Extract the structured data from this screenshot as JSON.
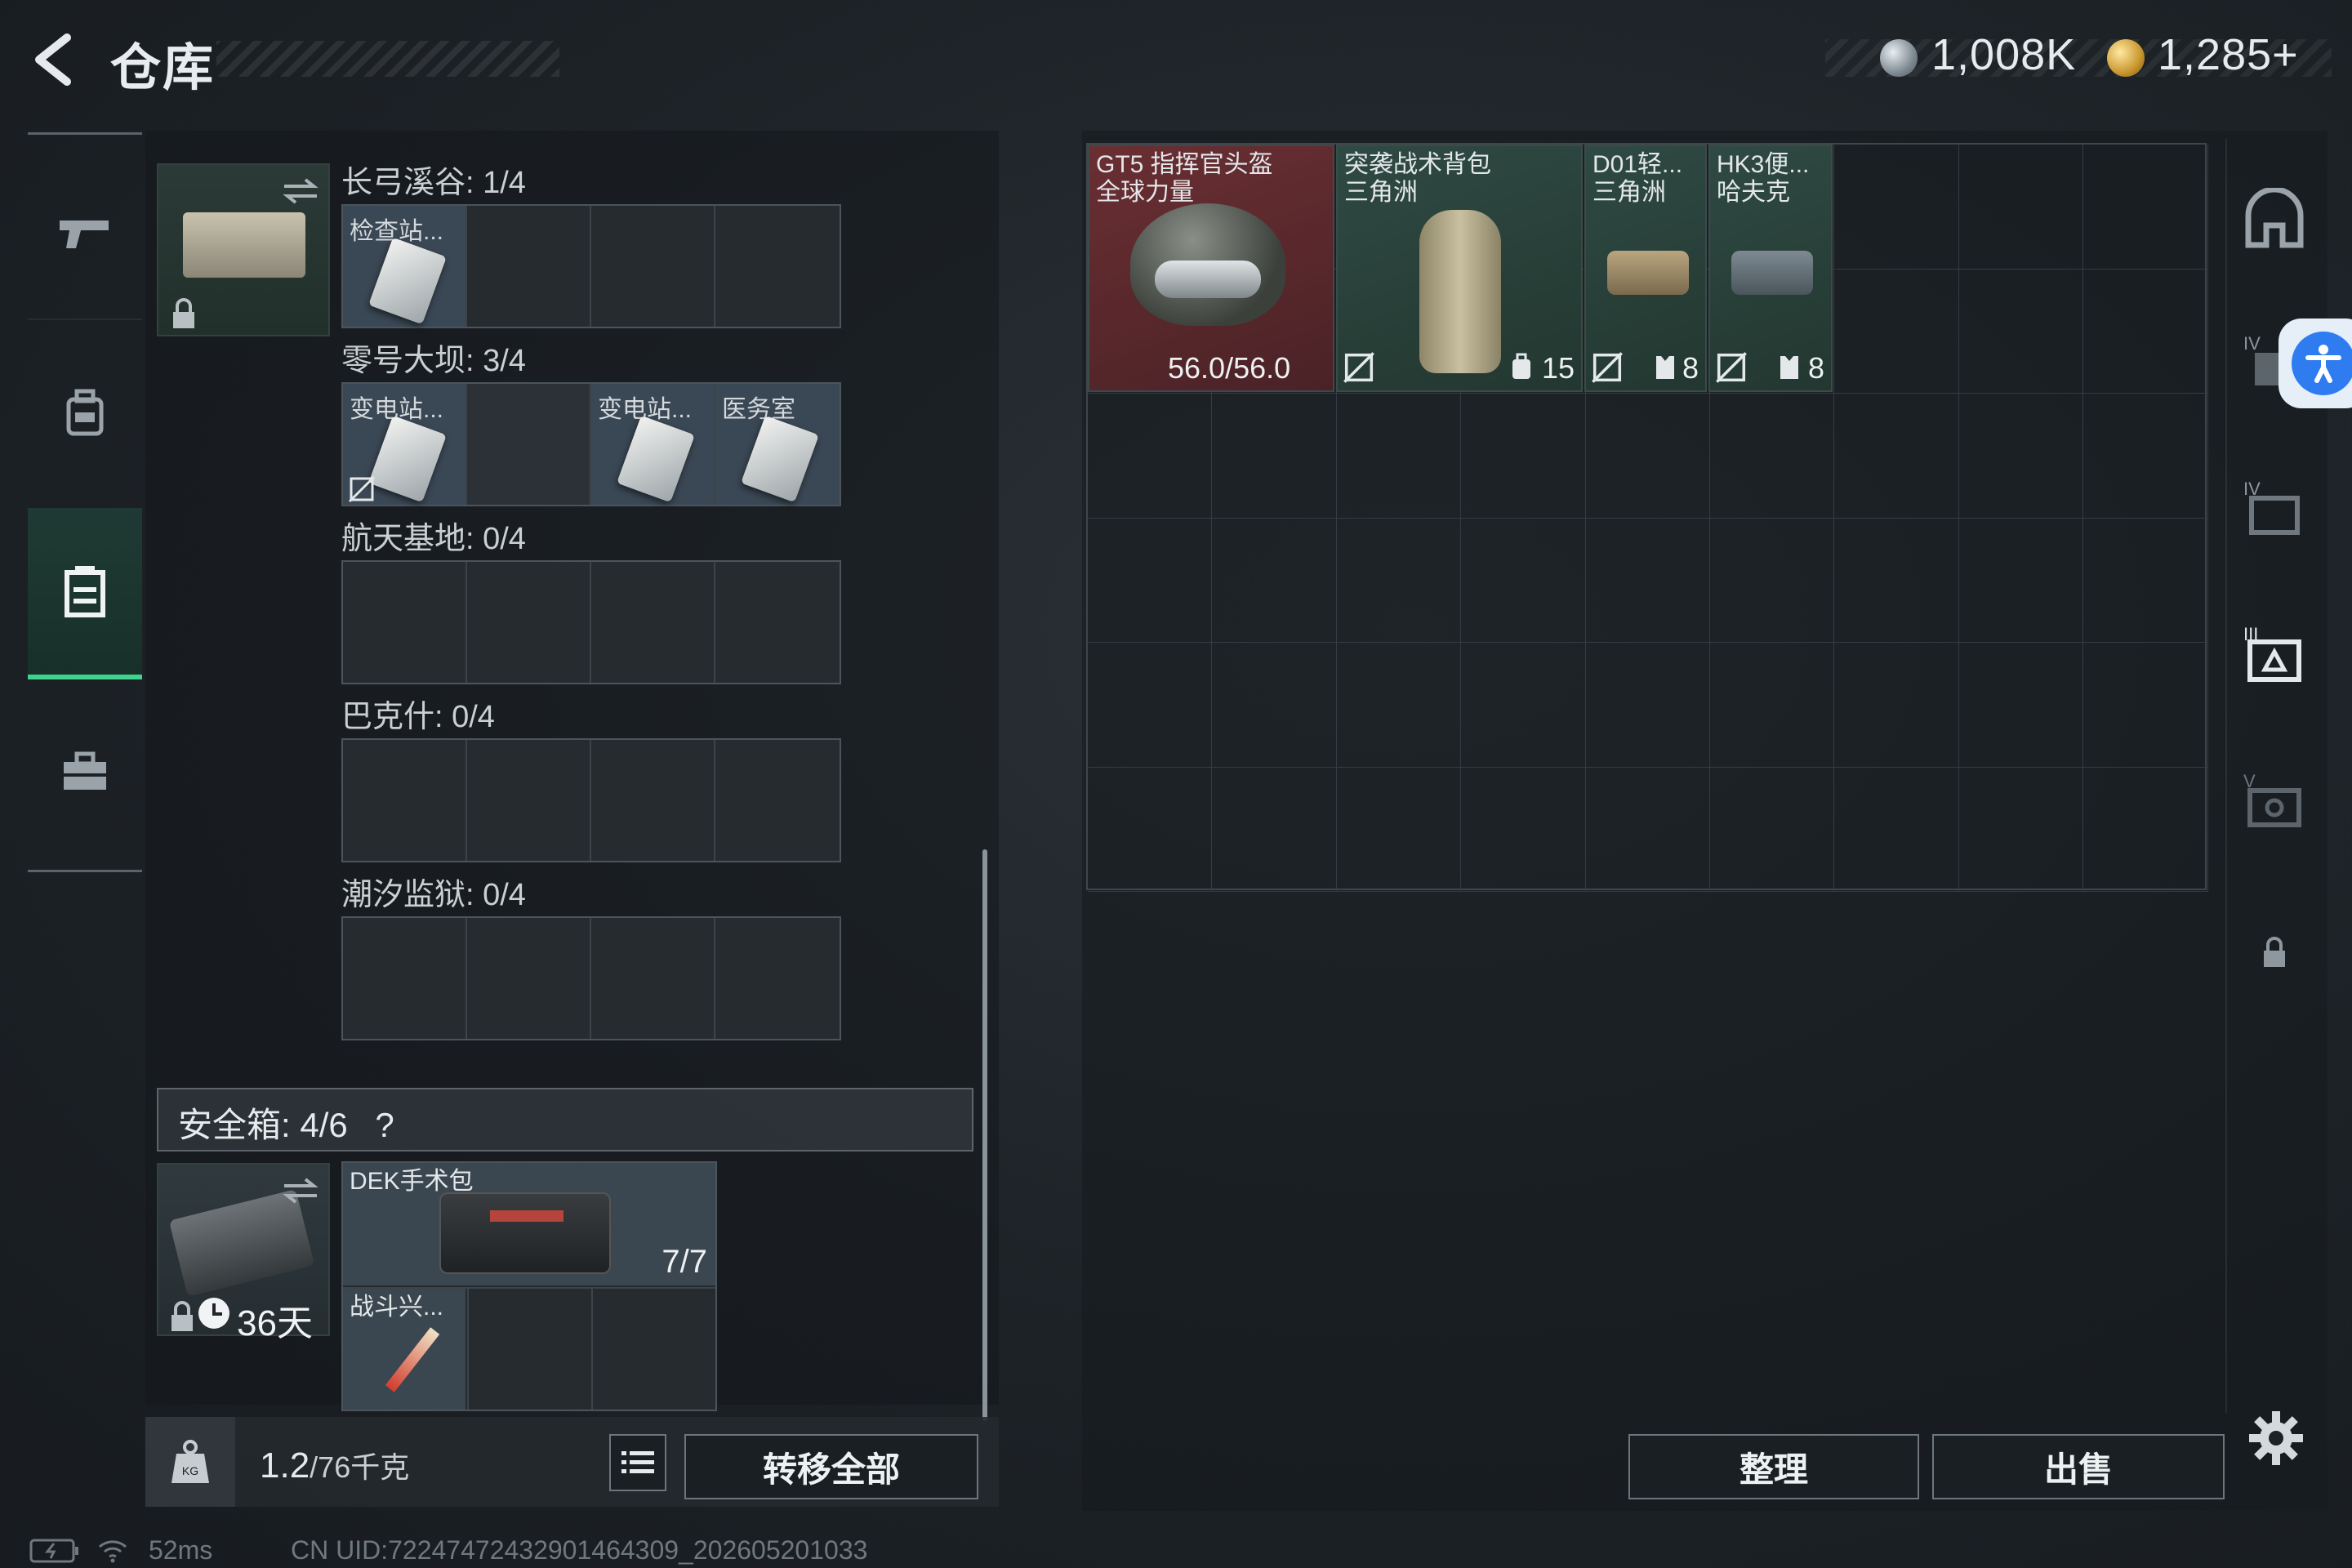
{
  "header": {
    "title": "仓库",
    "currency_silver": "1,008K",
    "currency_gold": "1,285+"
  },
  "nav": {
    "items": [
      "weapons",
      "equipment",
      "stash",
      "toolbox"
    ],
    "active": "stash"
  },
  "keycard_container": {
    "rows": [
      {
        "label": "长弓溪谷: 1/4",
        "cells": [
          "检查站...",
          "",
          "",
          ""
        ]
      },
      {
        "label": "零号大坝: 3/4",
        "cells": [
          "变电站...",
          "",
          "变电站...",
          "医务室"
        ]
      },
      {
        "label": "航天基地: 0/4",
        "cells": [
          "",
          "",
          "",
          ""
        ]
      },
      {
        "label": "巴克什: 0/4",
        "cells": [
          "",
          "",
          "",
          ""
        ]
      },
      {
        "label": "潮汐监狱: 0/4",
        "cells": [
          "",
          "",
          "",
          ""
        ]
      }
    ]
  },
  "safebox": {
    "label": "安全箱:  4/6",
    "help": "?",
    "timer": "36天",
    "items": [
      {
        "name": "DEK手术包",
        "count": "7/7"
      },
      {
        "name": "战斗兴..."
      }
    ]
  },
  "weight": {
    "value": "1.2",
    "max": "/76千克"
  },
  "buttons": {
    "transfer_all": "转移全部",
    "organize": "整理",
    "sell": "出售"
  },
  "stash_items": [
    {
      "name": "GT5 指挥官头盔",
      "sub": "全球力量",
      "value": "56.0/56.0",
      "color": "#5a2b2e"
    },
    {
      "name": "突袭战术背包",
      "sub": "三角洲",
      "value": "15",
      "color": "#27403a"
    },
    {
      "name": "D01轻...",
      "sub": "三角洲",
      "value": "8",
      "color": "#27403a"
    },
    {
      "name": "HK3便...",
      "sub": "哈夫克",
      "value": "8",
      "color": "#27403a"
    }
  ],
  "status": {
    "ping": "52ms",
    "uid": "CN UID:72247472432901464309_202605201033"
  }
}
